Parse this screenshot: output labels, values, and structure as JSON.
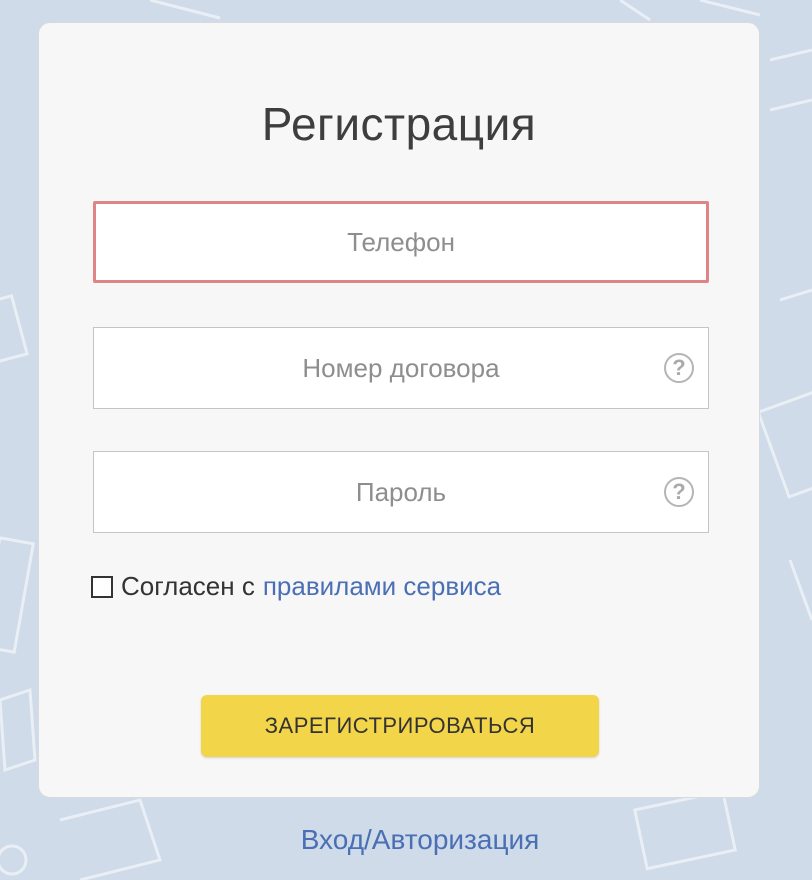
{
  "form": {
    "title": "Регистрация",
    "phone_placeholder": "Телефон",
    "contract_placeholder": "Номер договора",
    "password_placeholder": "Пароль",
    "help_glyph": "?",
    "agree_text": "Согласен с",
    "agree_link": "правилами сервиса",
    "submit_label": "ЗАРЕГИСТРИРОВАТЬСЯ"
  },
  "footer": {
    "login_link": "Вход/Авторизация"
  },
  "colors": {
    "background": "#cfdbe8",
    "card": "#f7f7f7",
    "error_border": "#e08585",
    "button": "#f3d54a",
    "link": "#4a6fb5"
  },
  "icons": {
    "help": "question-circle-icon"
  }
}
